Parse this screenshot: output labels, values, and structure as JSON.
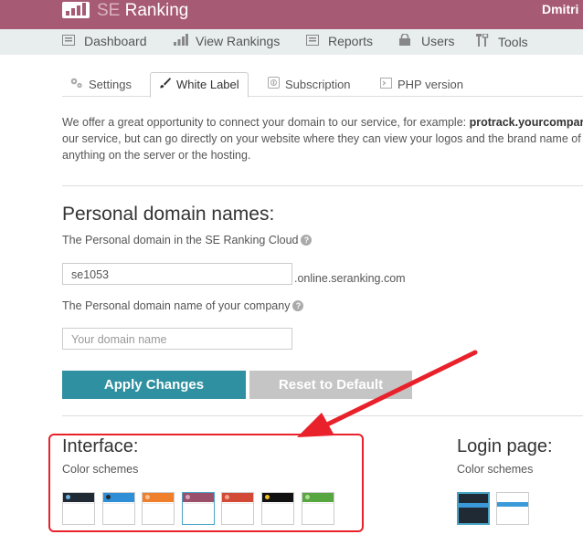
{
  "topbar": {
    "logo_se": "SE",
    "logo_ranking": "Ranking",
    "user": "Dmitri I",
    "bg_color": "#a65a74"
  },
  "nav": {
    "items": [
      {
        "label": "Dashboard",
        "icon": "dashboard-icon"
      },
      {
        "label": "View Rankings",
        "icon": "bar-chart-icon"
      },
      {
        "label": "Reports",
        "icon": "report-icon"
      },
      {
        "label": "Users",
        "icon": "lock-icon"
      },
      {
        "label": "Tools",
        "icon": "tools-icon"
      }
    ]
  },
  "tabs": [
    {
      "label": "Settings",
      "icon": "gears-icon",
      "active": false
    },
    {
      "label": "White Label",
      "icon": "brush-icon",
      "active": true
    },
    {
      "label": "Subscription",
      "icon": "subscription-icon",
      "active": false
    },
    {
      "label": "PHP version",
      "icon": "terminal-icon",
      "active": false
    }
  ],
  "intro": {
    "line1_pre": "We offer a great opportunity to connect your domain to our service, for example: ",
    "line1_bold": "protrack.yourcompar",
    "line2": "our service, but can go directly on your website where they can view your logos and the brand name of",
    "line3": "anything on the server or the hosting."
  },
  "domain_section": {
    "title": "Personal domain names:",
    "cloud_label": "The Personal domain in the SE Ranking Cloud",
    "cloud_value": "se1053",
    "cloud_suffix": ".online.seranking.com",
    "company_label": "The Personal domain name of your company",
    "company_placeholder": "Your domain name",
    "help_glyph": "?"
  },
  "buttons": {
    "apply": "Apply Changes",
    "reset": "Reset to Default"
  },
  "interface": {
    "title": "Interface:",
    "subtitle": "Color schemes",
    "schemes": [
      {
        "bar": "#1f2a35",
        "dot": "#6fb3e0",
        "selected": false
      },
      {
        "bar": "#2e8fd6",
        "dot": "#1f2a35",
        "selected": false
      },
      {
        "bar": "#ef7f2a",
        "dot": "#f7c39a",
        "selected": false
      },
      {
        "bar": "#9a4f6b",
        "dot": "#d7a5ba",
        "selected": true
      },
      {
        "bar": "#d24a35",
        "dot": "#f2a494",
        "selected": false
      },
      {
        "bar": "#111111",
        "dot": "#f2c21b",
        "selected": false
      },
      {
        "bar": "#58a640",
        "dot": "#aee098",
        "selected": false
      }
    ]
  },
  "login": {
    "title": "Login page:",
    "subtitle": "Color schemes"
  },
  "annotation": {
    "color": "#e8212a"
  }
}
